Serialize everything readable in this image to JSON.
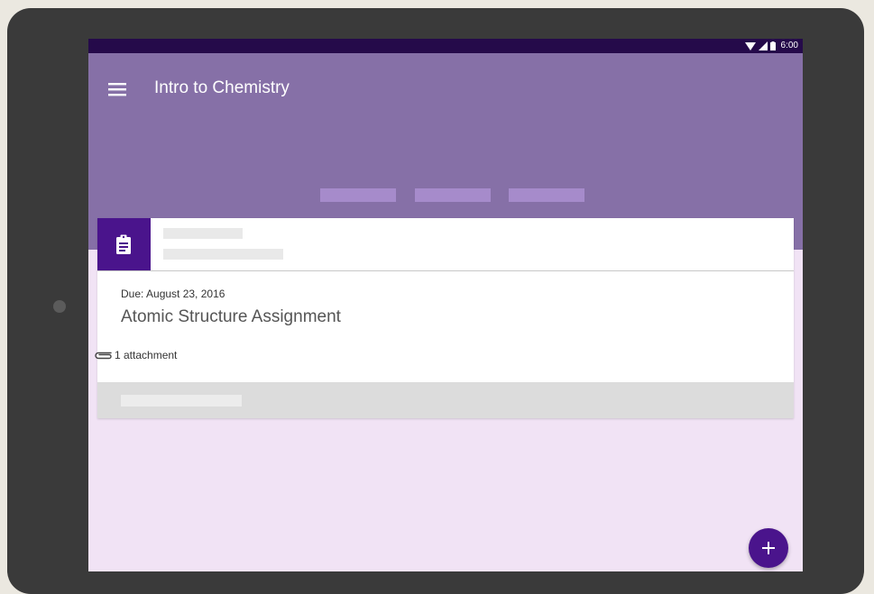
{
  "status_bar": {
    "time": "6:00",
    "icons": [
      "wifi-icon",
      "signal-icon",
      "battery-icon"
    ]
  },
  "app_bar": {
    "title": "Intro to Chemistry",
    "color": "#8670a7"
  },
  "assignment": {
    "due": "Due: August 23, 2016",
    "title": "Atomic Structure Assignment",
    "attachments": "1 attachment",
    "icon": "assignment-clipboard-icon"
  },
  "colors": {
    "status_bar": "#250a4a",
    "accent": "#4a148c",
    "background": "#f1e3f5",
    "tab_placeholder": "#a68bcb"
  },
  "fab": {
    "icon": "plus-icon"
  }
}
